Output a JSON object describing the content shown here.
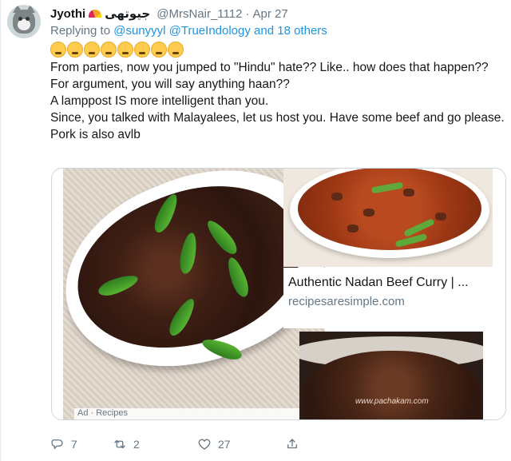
{
  "tweet": {
    "author_name": "Jyothi",
    "author_name_urdu": "جیوتھی",
    "handle": "@MrsNair_1112",
    "separator": "·",
    "date": "Apr 27",
    "replying_prefix": "Replying to",
    "replying_user1": "@sunyyyl",
    "replying_user2": "@TrueIndology",
    "replying_suffix": "and 18 others",
    "emojis": [
      "rolling-eyes-emoji",
      "thinking-emoji",
      "flushed-emoji",
      "flushed-emoji",
      "joy-emoji",
      "joy-emoji",
      "rofl-emoji",
      "rofl-emoji"
    ],
    "text": [
      "From parties, now you jumped to \"Hindu\" hate?? Like.. how does that happen??",
      "For argument, you will say anything haan??",
      "A lamppost IS more intelligent than you.",
      "Since, you talked with Malayalees, let us host you. Have some beef and go please. Pork is also avlb"
    ],
    "card": {
      "title": "Authentic Nadan Beef Curry | ...",
      "domain": "recipesaresimple.com"
    },
    "image_watermark": "www.pachakam.com",
    "carousel_label": "Ad · Recipes",
    "actions": {
      "replies": "7",
      "retweets": "2",
      "likes": "27"
    }
  },
  "colors": {
    "link": "#1b95e0",
    "muted": "#657786",
    "text": "#14171a",
    "border": "#ccd6dd"
  }
}
